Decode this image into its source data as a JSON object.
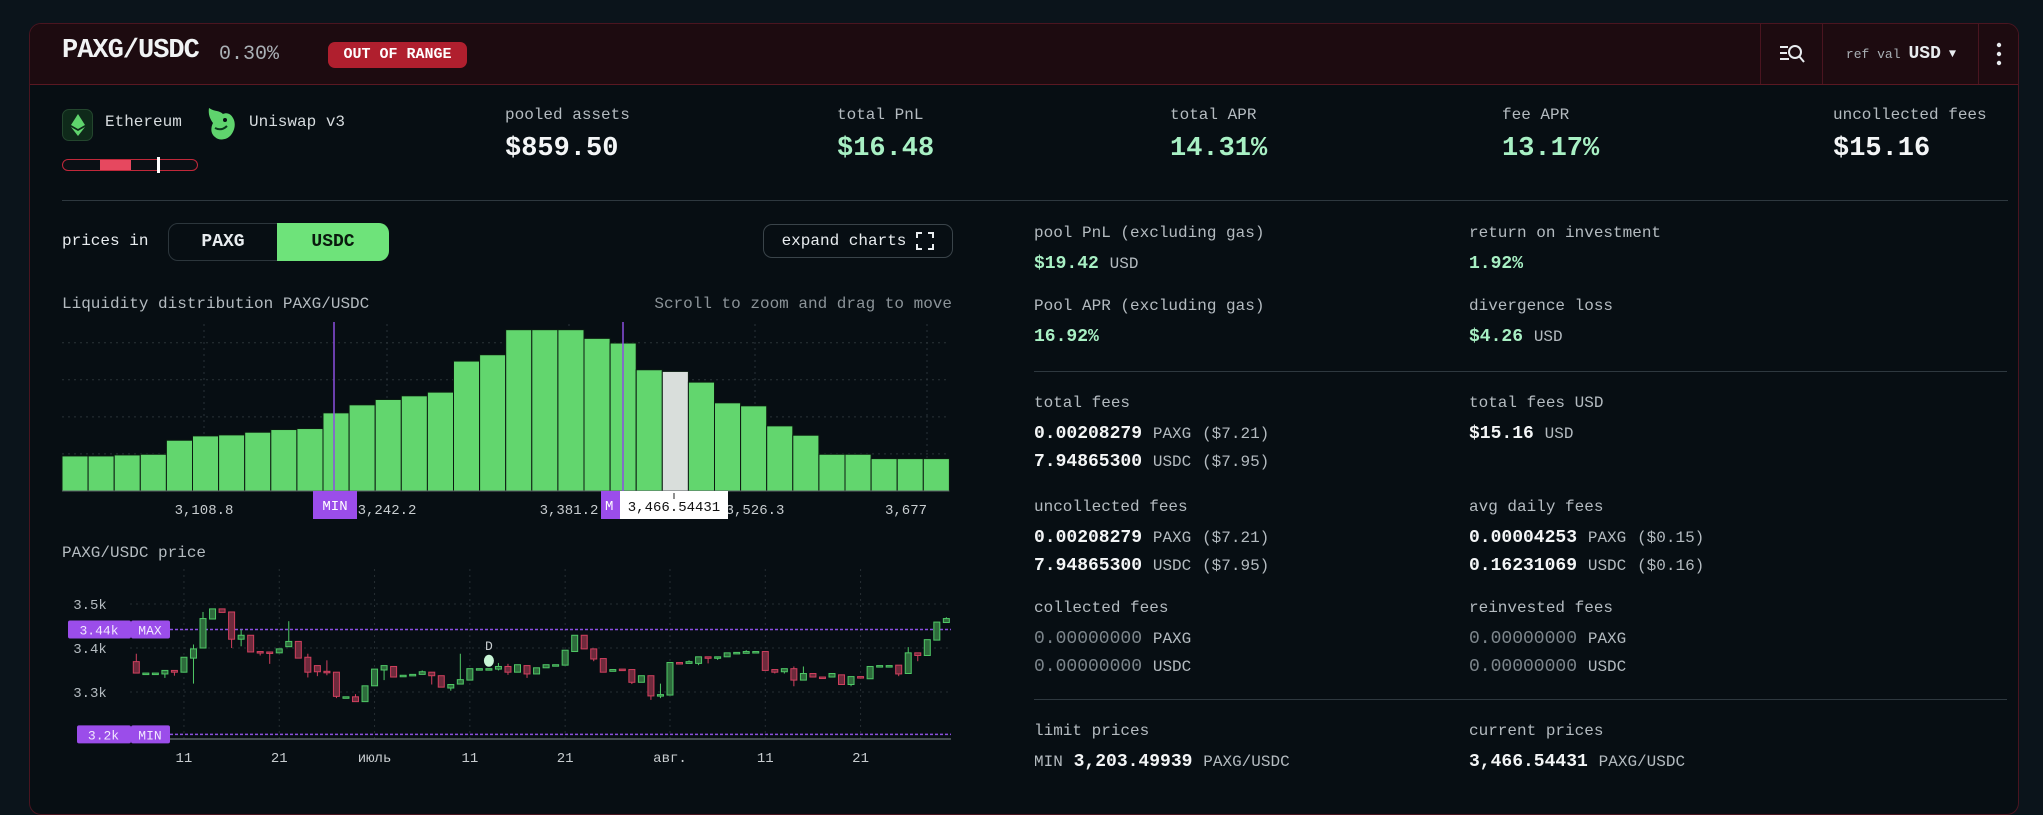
{
  "header": {
    "pair": "PAXG/USDC",
    "fee_tier": "0.30%",
    "status_badge": "OUT OF RANGE",
    "ref_val_label": "ref val",
    "ref_val_currency": "USD",
    "icons": [
      "search-list-icon",
      "caret-down-icon",
      "more-vertical-icon"
    ]
  },
  "position": {
    "network": "Ethereum",
    "protocol": "Uniswap v3",
    "range_fill_percent": 55
  },
  "stats": [
    {
      "label": "pooled assets",
      "value": "$859.50",
      "accent": "white"
    },
    {
      "label": "total PnL",
      "value": "$16.48",
      "accent": "mint"
    },
    {
      "label": "total APR",
      "value": "14.31%",
      "accent": "mint"
    },
    {
      "label": "fee APR",
      "value": "13.17%",
      "accent": "mint"
    },
    {
      "label": "uncollected fees",
      "value": "$15.16",
      "accent": "white"
    }
  ],
  "controls": {
    "prices_in_label": "prices in",
    "options": [
      "PAXG",
      "USDC"
    ],
    "selected": "USDC",
    "expand_label": "expand charts"
  },
  "chart_data": [
    {
      "type": "bar",
      "title": "Liquidity distribution PAXG/USDC",
      "hint": "Scroll to zoom and drag to move",
      "values": [
        10.5,
        10.5,
        10.8,
        11,
        15.2,
        16.5,
        16.8,
        17.6,
        18.4,
        18.7,
        23.4,
        25.8,
        27.4,
        28.5,
        29.6,
        38.9,
        40.8,
        48.3,
        48.3,
        48.3,
        45.7,
        44.3,
        36.3,
        35.8,
        32.6,
        26.4,
        25.5,
        19.5,
        16.7,
        11,
        11,
        9.7,
        9.7,
        9.7
      ],
      "current_bar_index": 23,
      "ylim": [
        0,
        50
      ],
      "grid": true,
      "x_tick_labels": [
        "3,108.8",
        "3,242.2",
        "3,381.2",
        "3,526.3",
        "3,677"
      ],
      "min_marker": "MIN",
      "max_marker": "M",
      "current_price_label": "3,466.54431"
    },
    {
      "type": "candlestick",
      "title": "PAXG/USDC price",
      "ylim": [
        3193,
        3557
      ],
      "y_ticks": [
        {
          "value": 3500,
          "label": "3.5k"
        },
        {
          "value": 3400,
          "label": "3.4k"
        },
        {
          "value": 3300,
          "label": "3.3k"
        }
      ],
      "max_line": {
        "value": 3442,
        "label": "3.44k",
        "tag": "MAX"
      },
      "min_line": {
        "value": 3203.5,
        "label": "3.2k",
        "tag": "MIN"
      },
      "x_ticks": [
        {
          "day": 5,
          "label": "11"
        },
        {
          "day": 15,
          "label": "21"
        },
        {
          "day": 25,
          "label": "июль"
        },
        {
          "day": 35,
          "label": "11"
        },
        {
          "day": 45,
          "label": "21"
        },
        {
          "day": 56,
          "label": "авг."
        },
        {
          "day": 66,
          "label": "11"
        },
        {
          "day": 76,
          "label": "21"
        }
      ],
      "marker": {
        "day": 37,
        "price": 3371,
        "label": "D"
      },
      "candles_ohlc": [
        [
          3369,
          3387,
          3342,
          3343
        ],
        [
          3343,
          3343,
          3343,
          3343
        ],
        [
          3343,
          3343,
          3343,
          3343
        ],
        [
          3341,
          3349,
          3332,
          3349
        ],
        [
          3349,
          3349,
          3337,
          3345
        ],
        [
          3345,
          3379,
          3345,
          3379
        ],
        [
          3377,
          3408,
          3319,
          3398
        ],
        [
          3400,
          3482,
          3400,
          3467
        ],
        [
          3466,
          3489,
          3466,
          3489
        ],
        [
          3489,
          3489,
          3481,
          3481
        ],
        [
          3482,
          3482,
          3400,
          3420
        ],
        [
          3420,
          3442,
          3404,
          3429
        ],
        [
          3429,
          3429,
          3391,
          3391
        ],
        [
          3392,
          3392,
          3383,
          3390
        ],
        [
          3391,
          3391,
          3364,
          3390
        ],
        [
          3389,
          3398,
          3389,
          3398
        ],
        [
          3403,
          3461,
          3403,
          3415
        ],
        [
          3415,
          3415,
          3377,
          3377
        ],
        [
          3379,
          3387,
          3333,
          3345
        ],
        [
          3360,
          3360,
          3336,
          3346
        ],
        [
          3347,
          3372,
          3338,
          3345
        ],
        [
          3345,
          3345,
          3286,
          3290
        ],
        [
          3289,
          3289,
          3289,
          3289
        ],
        [
          3289,
          3295,
          3278,
          3278
        ],
        [
          3278,
          3314,
          3278,
          3314
        ],
        [
          3314,
          3352,
          3314,
          3352
        ],
        [
          3350,
          3360,
          3327,
          3360
        ],
        [
          3358,
          3358,
          3334,
          3334
        ],
        [
          3338,
          3338,
          3338,
          3338
        ],
        [
          3340,
          3340,
          3340,
          3340
        ],
        [
          3340,
          3349,
          3340,
          3346
        ],
        [
          3345,
          3345,
          3317,
          3337
        ],
        [
          3337,
          3337,
          3311,
          3311
        ],
        [
          3309,
          3317,
          3303,
          3317
        ],
        [
          3318,
          3387,
          3318,
          3328
        ],
        [
          3327,
          3353,
          3327,
          3353
        ],
        [
          3353,
          3353,
          3353,
          3353
        ],
        [
          3353,
          3353,
          3353,
          3353
        ],
        [
          3352,
          3366,
          3349,
          3358
        ],
        [
          3358,
          3364,
          3339,
          3345
        ],
        [
          3345,
          3362,
          3345,
          3362
        ],
        [
          3360,
          3360,
          3332,
          3341
        ],
        [
          3341,
          3355,
          3341,
          3355
        ],
        [
          3355,
          3362,
          3355,
          3362
        ],
        [
          3362,
          3362,
          3362,
          3362
        ],
        [
          3361,
          3395,
          3361,
          3395
        ],
        [
          3392,
          3429,
          3392,
          3429
        ],
        [
          3429,
          3429,
          3398,
          3398
        ],
        [
          3398,
          3398,
          3370,
          3375
        ],
        [
          3376,
          3376,
          3345,
          3345
        ],
        [
          3347,
          3351,
          3347,
          3351
        ],
        [
          3352,
          3352,
          3350,
          3350
        ],
        [
          3351,
          3351,
          3318,
          3322
        ],
        [
          3322,
          3337,
          3322,
          3337
        ],
        [
          3337,
          3337,
          3282,
          3291
        ],
        [
          3293,
          3319,
          3286,
          3294
        ],
        [
          3293,
          3367,
          3293,
          3367
        ],
        [
          3367,
          3367,
          3364,
          3364
        ],
        [
          3365,
          3372,
          3365,
          3369
        ],
        [
          3365,
          3380,
          3361,
          3380
        ],
        [
          3380,
          3380,
          3365,
          3377
        ],
        [
          3377,
          3380,
          3373,
          3380
        ],
        [
          3380,
          3389,
          3380,
          3389
        ],
        [
          3388,
          3390,
          3388,
          3390
        ],
        [
          3388,
          3395,
          3388,
          3392
        ],
        [
          3390,
          3392,
          3390,
          3392
        ],
        [
          3392,
          3392,
          3349,
          3349
        ],
        [
          3351,
          3351,
          3342,
          3345
        ],
        [
          3346,
          3353,
          3342,
          3353
        ],
        [
          3353,
          3358,
          3313,
          3327
        ],
        [
          3327,
          3358,
          3327,
          3342
        ],
        [
          3342,
          3342,
          3334,
          3334
        ],
        [
          3334,
          3334,
          3332,
          3332
        ],
        [
          3334,
          3342,
          3334,
          3342
        ],
        [
          3339,
          3339,
          3317,
          3317
        ],
        [
          3317,
          3335,
          3313,
          3335
        ],
        [
          3335,
          3335,
          3332,
          3332
        ],
        [
          3330,
          3358,
          3330,
          3358
        ],
        [
          3357,
          3360,
          3357,
          3360
        ],
        [
          3360,
          3360,
          3360,
          3360
        ],
        [
          3361,
          3361,
          3336,
          3341
        ],
        [
          3342,
          3402,
          3342,
          3389
        ],
        [
          3389,
          3389,
          3370,
          3383
        ],
        [
          3383,
          3419,
          3383,
          3419
        ],
        [
          3418,
          3459,
          3418,
          3459
        ],
        [
          3458,
          3470,
          3458,
          3467
        ]
      ],
      "up_color": "#4fc866",
      "down_color": "#d0405e"
    }
  ],
  "details": {
    "pool_pnl": {
      "label": "pool PnL (excluding gas)",
      "value": "$19.42",
      "unit": "USD"
    },
    "roi": {
      "label": "return on investment",
      "value": "1.92%"
    },
    "pool_apr": {
      "label": "Pool APR (excluding gas)",
      "value": "16.92%"
    },
    "divergence_loss": {
      "label": "divergence loss",
      "value": "$4.26",
      "unit": "USD"
    },
    "total_fees": {
      "label": "total fees",
      "rows": [
        {
          "amount": "0.00208279",
          "token": "PAXG",
          "usd": "($7.21)"
        },
        {
          "amount": "7.94865300",
          "token": "USDC",
          "usd": "($7.95)"
        }
      ]
    },
    "total_fees_usd": {
      "label": "total fees USD",
      "value": "$15.16",
      "unit": "USD"
    },
    "uncollected_fees": {
      "label": "uncollected fees",
      "rows": [
        {
          "amount": "0.00208279",
          "token": "PAXG",
          "usd": "($7.21)"
        },
        {
          "amount": "7.94865300",
          "token": "USDC",
          "usd": "($7.95)"
        }
      ]
    },
    "avg_daily_fees": {
      "label": "avg daily fees",
      "rows": [
        {
          "amount": "0.00004253",
          "token": "PAXG",
          "usd": "($0.15)"
        },
        {
          "amount": "0.16231069",
          "token": "USDC",
          "usd": "($0.16)"
        }
      ]
    },
    "collected_fees": {
      "label": "collected fees",
      "rows": [
        {
          "amount": "0.00000000",
          "token": "PAXG"
        },
        {
          "amount": "0.00000000",
          "token": "USDC"
        }
      ]
    },
    "reinvested_fees": {
      "label": "reinvested fees",
      "rows": [
        {
          "amount": "0.00000000",
          "token": "PAXG"
        },
        {
          "amount": "0.00000000",
          "token": "USDC"
        }
      ]
    },
    "limit_prices": {
      "label": "limit prices",
      "prefix": "MIN",
      "value": "3,203.49939",
      "unit": "PAXG/USDC"
    },
    "current_prices": {
      "label": "current prices",
      "value": "3,466.54431",
      "unit": "PAXG/USDC"
    }
  },
  "colors": {
    "accent_green": "#6ee37a",
    "mint": "#a8f0c4",
    "danger": "#b01f2e",
    "range_purple": "#9b4dea"
  }
}
